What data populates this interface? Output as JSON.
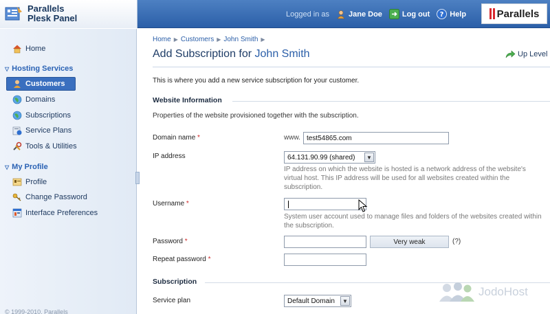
{
  "app": {
    "logo_line1": "Parallels",
    "logo_line2": "Plesk Panel",
    "brand": "Parallels",
    "accent": "#2b5fa8"
  },
  "topbar": {
    "logged_in_as": "Logged in as",
    "user": "Jane Doe",
    "logout": "Log out",
    "help": "Help"
  },
  "sidebar": {
    "home": "Home",
    "hosting_section": "Hosting Services",
    "hosting_items": [
      "Customers",
      "Domains",
      "Subscriptions",
      "Service Plans",
      "Tools & Utilities"
    ],
    "profile_section": "My Profile",
    "profile_items": [
      "Profile",
      "Change Password",
      "Interface Preferences"
    ],
    "footer": "© 1999-2010, Parallels"
  },
  "breadcrumb": [
    "Home",
    "Customers",
    "John Smith"
  ],
  "page": {
    "title_prefix": "Add Subscription for",
    "title_customer": "John Smith",
    "up_level": "Up Level",
    "intro": "This is where you add a new service subscription for your customer."
  },
  "website_info": {
    "heading": "Website Information",
    "description": "Properties of the website provisioned together with the subscription.",
    "domain_label": "Domain name",
    "domain_prefix": "www.",
    "domain_value": "test54865.com",
    "ip_label": "IP address",
    "ip_value": "64.131.90.99 (shared)",
    "ip_help": "IP address on which the website is hosted is a network address of the website's virtual host. This IP address will be used for all websites created within the subscription.",
    "username_label": "Username",
    "username_value": "",
    "username_help": "System user account used to manage files and folders of the websites created within the subscription.",
    "password_label": "Password",
    "password_strength": "Very weak",
    "password_strength_help": "(?)",
    "repeat_password_label": "Repeat password",
    "required_mark": "*"
  },
  "subscription": {
    "heading": "Subscription",
    "service_plan_label": "Service plan",
    "service_plan_value": "Default Domain"
  },
  "watermark": "JodoHost"
}
